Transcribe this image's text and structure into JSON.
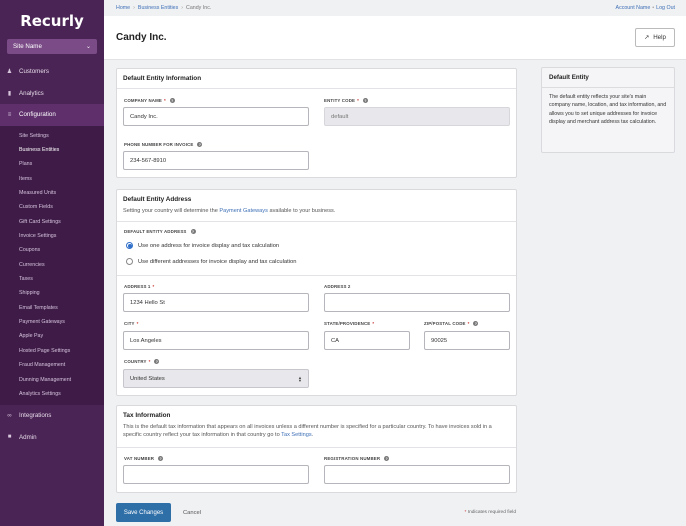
{
  "brand": "Recurly",
  "site_select": "Site Name",
  "nav": {
    "customers": "Customers",
    "analytics": "Analytics",
    "configuration": "Configuration",
    "integrations": "Integrations",
    "admin": "Admin"
  },
  "subnav": [
    "Site Settings",
    "Business Entities",
    "Plans",
    "Items",
    "Measured Units",
    "Custom Fields",
    "Gift Card Settings",
    "Invoice Settings",
    "Coupons",
    "Currencies",
    "Taxes",
    "Shipping",
    "Email Templates",
    "Payment Gateways",
    "Apple Pay",
    "Hosted Page Settings",
    "Fraud Management",
    "Dunning Management",
    "Analytics Settings"
  ],
  "breadcrumb": {
    "home": "Home",
    "entities": "Business Entities",
    "current": "Candy Inc."
  },
  "account": {
    "name": "Account Name",
    "logout": "Log Out"
  },
  "page_title": "Candy Inc.",
  "help_label": "Help",
  "entity_info": {
    "title": "Default Entity Information",
    "company_label": "COMPANY NAME",
    "company_value": "Candy Inc.",
    "code_label": "ENTITY CODE",
    "code_value": "default",
    "phone_label": "PHONE NUMBER FOR INVOICE",
    "phone_value": "234-567-8910"
  },
  "address": {
    "title": "Default Entity Address",
    "subtitle_pre": "Setting your country will determine the ",
    "subtitle_link": "Payment Gateways",
    "subtitle_post": " available to your business.",
    "default_label": "DEFAULT ENTITY ADDRESS",
    "option_one": "Use one address for invoice display and tax calculation",
    "option_two": "Use different addresses for invoice display and tax calculation",
    "address1_label": "ADDRESS 1",
    "address1_value": "1234 Hello St",
    "address2_label": "ADDRESS 2",
    "address2_value": "",
    "city_label": "CITY",
    "city_value": "Los Angeles",
    "state_label": "STATE/PROVIDENCE",
    "state_value": "CA",
    "zip_label": "ZIP/POSTAL CODE",
    "zip_value": "90025",
    "country_label": "COUNTRY",
    "country_value": "United States"
  },
  "tax": {
    "title": "Tax Information",
    "desc_pre": "This is the default tax information that appears on all invoices unless a different number is specified for a particular country. To have invoices sold in a specific country reflect your tax information in that country go to ",
    "desc_link": "Tax Settings",
    "desc_post": ".",
    "vat_label": "VAT NUMBER",
    "vat_value": "",
    "reg_label": "REGISTRATION NUMBER",
    "reg_value": ""
  },
  "side_panel": {
    "title": "Default Entity",
    "body": "The default entity reflects your site's main company name, location, and tax information, and allows you to set unique addresses for invoice display and merchant address tax calculation."
  },
  "footer": {
    "save": "Save Changes",
    "cancel": "Cancel",
    "required_note": "Indicates required field",
    "required_mark": "*"
  },
  "colors": {
    "sidebar": "#4a2454",
    "accent": "#2f6fa8",
    "link": "#3d6fb6",
    "required": "#c8322e"
  }
}
